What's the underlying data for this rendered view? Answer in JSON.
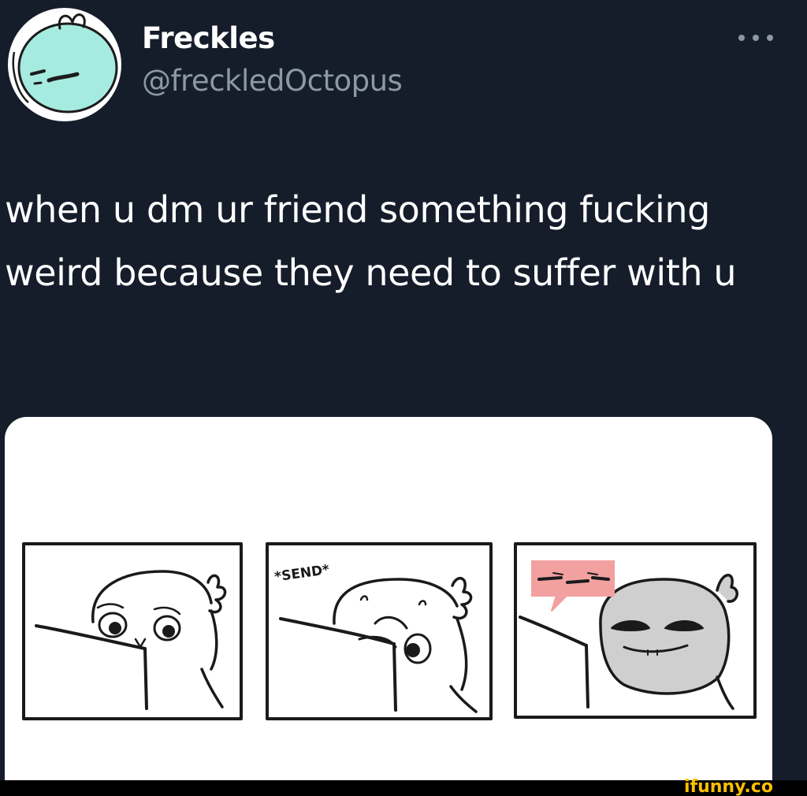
{
  "tweet": {
    "author": {
      "display_name": "Freckles",
      "handle": "@freckledOctopus"
    },
    "text": "when u dm ur friend something fucking weird because they need to suffer with u",
    "more_icon": "more-horizontal-icon"
  },
  "comic": {
    "panels": 3,
    "panel_2_caption": "*SEND*"
  },
  "watermark": {
    "text": "ifunny.co"
  },
  "colors": {
    "background": "#151d2b",
    "text_primary": "#ffffff",
    "text_secondary": "#8b98a5",
    "avatar_bg": "#9fe8dd",
    "watermark": "#ffc000",
    "speech_bubble": "#f2a0a0"
  }
}
